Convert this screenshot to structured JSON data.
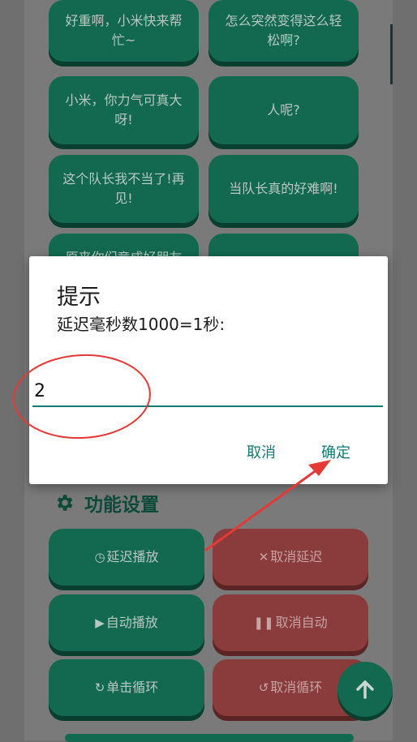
{
  "sound_buttons": [
    {
      "label": "好重啊，小米快来帮忙~"
    },
    {
      "label": "怎么突然变得这么轻松啊?"
    },
    {
      "label": "小米，你力气可真大呀!"
    },
    {
      "label": "人呢?"
    },
    {
      "label": "这个队长我不当了!再见!"
    },
    {
      "label": "当队长真的好难啊!"
    },
    {
      "label": "原来你们竟成好朋友"
    },
    {
      "label": ""
    }
  ],
  "settings": {
    "title": "功能设置",
    "delay_play": "延迟播放",
    "cancel_delay": "取消延迟",
    "auto_play": "自动播放",
    "cancel_auto": "取消自动",
    "single_loop": "单击循环",
    "cancel_loop": "取消循环"
  },
  "dialog": {
    "title": "提示",
    "message": "延迟毫秒数1000=1秒:",
    "input_value": "2",
    "cancel_label": "取消",
    "ok_label": "确定"
  },
  "colors": {
    "accent": "#0f7c72",
    "green_button": "#12694f",
    "red_button": "#8a3b3b",
    "annotation": "#e53935"
  },
  "icons": {
    "fab": "arrow-up-icon",
    "settings": "gear-icon"
  }
}
